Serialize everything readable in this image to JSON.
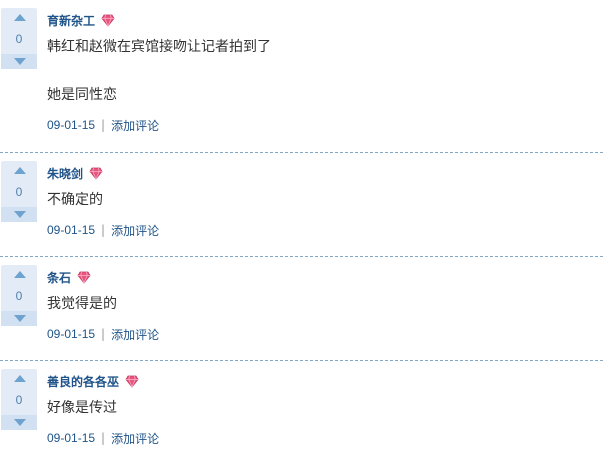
{
  "answers": [
    {
      "votes": "0",
      "username": "育新杂工",
      "badge_icon": "pink-gem-icon",
      "lines": [
        "韩红和赵微在宾馆接吻让记者拍到了",
        "她是同性恋"
      ],
      "date": "09-01-15",
      "separator": "|",
      "comment_label": "添加评论"
    },
    {
      "votes": "0",
      "username": "朱晓剑",
      "badge_icon": "pink-gem-icon",
      "lines": [
        "不确定的"
      ],
      "date": "09-01-15",
      "separator": "|",
      "comment_label": "添加评论"
    },
    {
      "votes": "0",
      "username": "条石",
      "badge_icon": "pink-gem-icon",
      "lines": [
        "我觉得是的"
      ],
      "date": "09-01-15",
      "separator": "|",
      "comment_label": "添加评论"
    },
    {
      "votes": "0",
      "username": "善良的各各巫",
      "badge_icon": "pink-gem-icon",
      "lines": [
        "好像是传过"
      ],
      "date": "09-01-15",
      "separator": "|",
      "comment_label": "添加评论"
    }
  ],
  "colors": {
    "link": "#20548a",
    "vote_bg": "#e3ecf6",
    "vote_arrow": "#6ea3cf",
    "divider": "#7fa9c8",
    "gem": "#e8557e"
  }
}
